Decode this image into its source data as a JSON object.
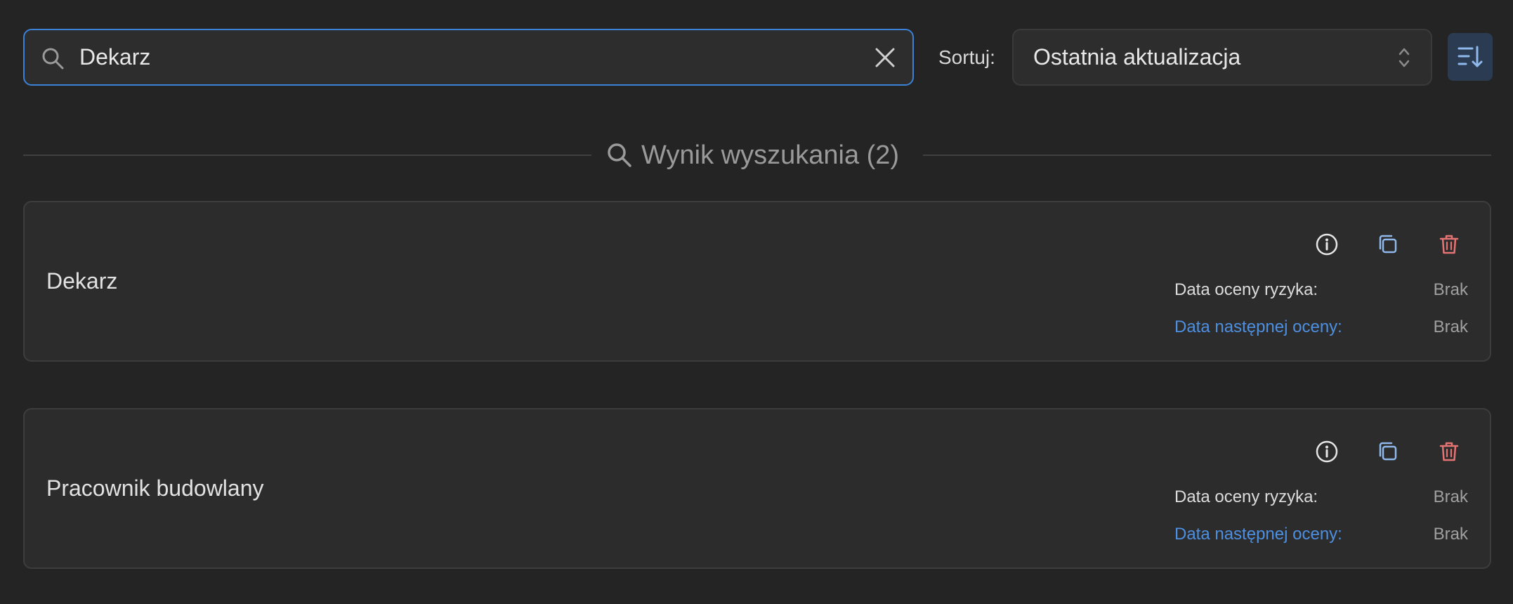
{
  "search": {
    "value": "Dekarz",
    "icon": "search-icon",
    "clear_icon": "close-icon"
  },
  "sort": {
    "label": "Sortuj:",
    "selected": "Ostatnia aktualizacja",
    "direction_icon": "sort-descending-icon"
  },
  "results": {
    "title": "Wynik wyszukania (2)",
    "icon": "search-icon"
  },
  "cards": [
    {
      "title": "Dekarz",
      "risk_label": "Data oceny ryzyka:",
      "risk_value": "Brak",
      "next_label": "Data następnej oceny:",
      "next_value": "Brak"
    },
    {
      "title": "Pracownik budowlany",
      "risk_label": "Data oceny ryzyka:",
      "risk_value": "Brak",
      "next_label": "Data następnej oceny:",
      "next_value": "Brak"
    }
  ],
  "colors": {
    "background": "#242424",
    "accent": "#3b82d6",
    "link": "#4d8fe0",
    "delete": "#e57373",
    "copy": "#8fb8ec"
  }
}
